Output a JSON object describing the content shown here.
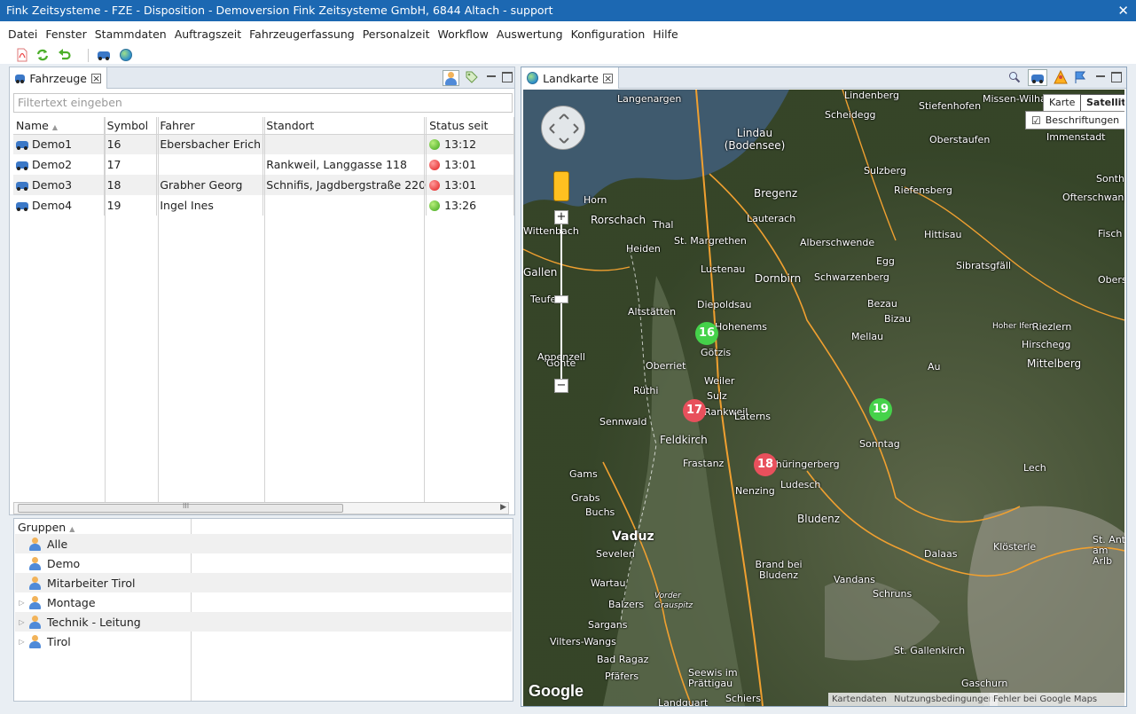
{
  "window": {
    "title": "Fink Zeitsysteme - FZE - Disposition - Demoversion Fink Zeitsysteme GmbH, 6844 Altach - support",
    "close_label": "✕"
  },
  "menu": [
    "Datei",
    "Fenster",
    "Stammdaten",
    "Auftragszeit",
    "Fahrzeugerfassung",
    "Personalzeit",
    "Workflow",
    "Auswertung",
    "Konfiguration",
    "Hilfe"
  ],
  "toolbar_icons": [
    "pdf-icon",
    "refresh-icon",
    "undo-icon",
    "vehicle-icon",
    "globe-icon"
  ],
  "vehicles_panel": {
    "tab_label": "Fahrzeuge",
    "filter_placeholder": "Filtertext eingeben",
    "columns": [
      "Name",
      "Symbol",
      "Fahrer",
      "Standort",
      "Status seit"
    ],
    "rows": [
      {
        "name": "Demo1",
        "symbol": "16",
        "driver": "Ebersbacher Erich",
        "location": "",
        "status_time": "13:12",
        "status_color": "green"
      },
      {
        "name": "Demo2",
        "symbol": "17",
        "driver": "",
        "location": "Rankweil, Langgasse 118",
        "status_time": "13:01",
        "status_color": "red"
      },
      {
        "name": "Demo3",
        "symbol": "18",
        "driver": "Grabher Georg",
        "location": "Schnifis, Jagdbergstraße 220",
        "status_time": "13:01",
        "status_color": "red"
      },
      {
        "name": "Demo4",
        "symbol": "19",
        "driver": "Ingel Ines",
        "location": "",
        "status_time": "13:26",
        "status_color": "green"
      }
    ],
    "scroll_thumb_label": "III"
  },
  "groups_panel": {
    "header": "Gruppen",
    "groups": [
      {
        "label": "Alle",
        "expandable": false
      },
      {
        "label": "Demo",
        "expandable": false
      },
      {
        "label": "Mitarbeiter Tirol",
        "expandable": false
      },
      {
        "label": "Montage",
        "expandable": true
      },
      {
        "label": "Technik - Leitung",
        "expandable": true
      },
      {
        "label": "Tirol",
        "expandable": true
      }
    ]
  },
  "map_panel": {
    "tab_label": "Landkarte",
    "maptype_options": [
      "Karte",
      "Satellit"
    ],
    "selected_maptype": "Satellit",
    "labels_option": "Beschriftungen",
    "labels_checked": true,
    "markers": [
      {
        "label": "16",
        "color": "green"
      },
      {
        "label": "17",
        "color": "red"
      },
      {
        "label": "18",
        "color": "red"
      },
      {
        "label": "19",
        "color": "green"
      }
    ],
    "place_names": [
      "Langenargen",
      "Lindenberg",
      "Stiefenhofen",
      "Missen-Wilha",
      "Scheidegg",
      "Lindau (Bodensee)",
      "Oberstaufen",
      "Immenstadt",
      "Sulzberg",
      "Sonth",
      "Bregenz",
      "Riefensberg",
      "Ofterschwang",
      "Horn",
      "Rorschach",
      "Lauterach",
      "Hittisau",
      "Fisch",
      "Wittenbach",
      "Thal",
      "St. Margrethen",
      "Alberschwende",
      "Heiden",
      "Egg",
      "Sibratsgfäll",
      "Gallen",
      "Lustenau",
      "Dornbirn",
      "Schwarzenberg",
      "Obers",
      "Teufen",
      "Diepoldsau",
      "Bezau",
      "Altstätten",
      "Hohenems",
      "Bizau",
      "Riezlern",
      "Mellau",
      "Hoher Ifen",
      "Hirschegg",
      "Appenzell",
      "Oberriet",
      "Götzis",
      "Au",
      "Mittelberg",
      "Weiler",
      "Rüthi",
      "Sulz",
      "Rankweil",
      "Laterns",
      "Sennwald",
      "Feldkirch",
      "Sonntag",
      "Frastanz",
      "Thüringerberg",
      "Gams",
      "Nenzing",
      "Ludesch",
      "Lech",
      "Grabs",
      "Buchs",
      "Bludenz",
      "Vaduz",
      "St. Ant am Arlb",
      "Sevelen",
      "Dalaas",
      "Klösterle",
      "Brand bei Bludenz",
      "Wartau",
      "Vandans",
      "Balzers",
      "Schruns",
      "Vorder Grauspitz",
      "Sargans",
      "Vilters-Wangs",
      "Bad Ragaz",
      "St. Gallenkirch",
      "Pfäfers",
      "Seewis im Prättigau",
      "Gaschurn",
      "Schiers",
      "Landquart",
      "Gonte"
    ],
    "attribution": [
      "Kartendaten",
      "Nutzungsbedingungen",
      "Fehler bei Google Maps melden"
    ],
    "logo": "Google"
  }
}
